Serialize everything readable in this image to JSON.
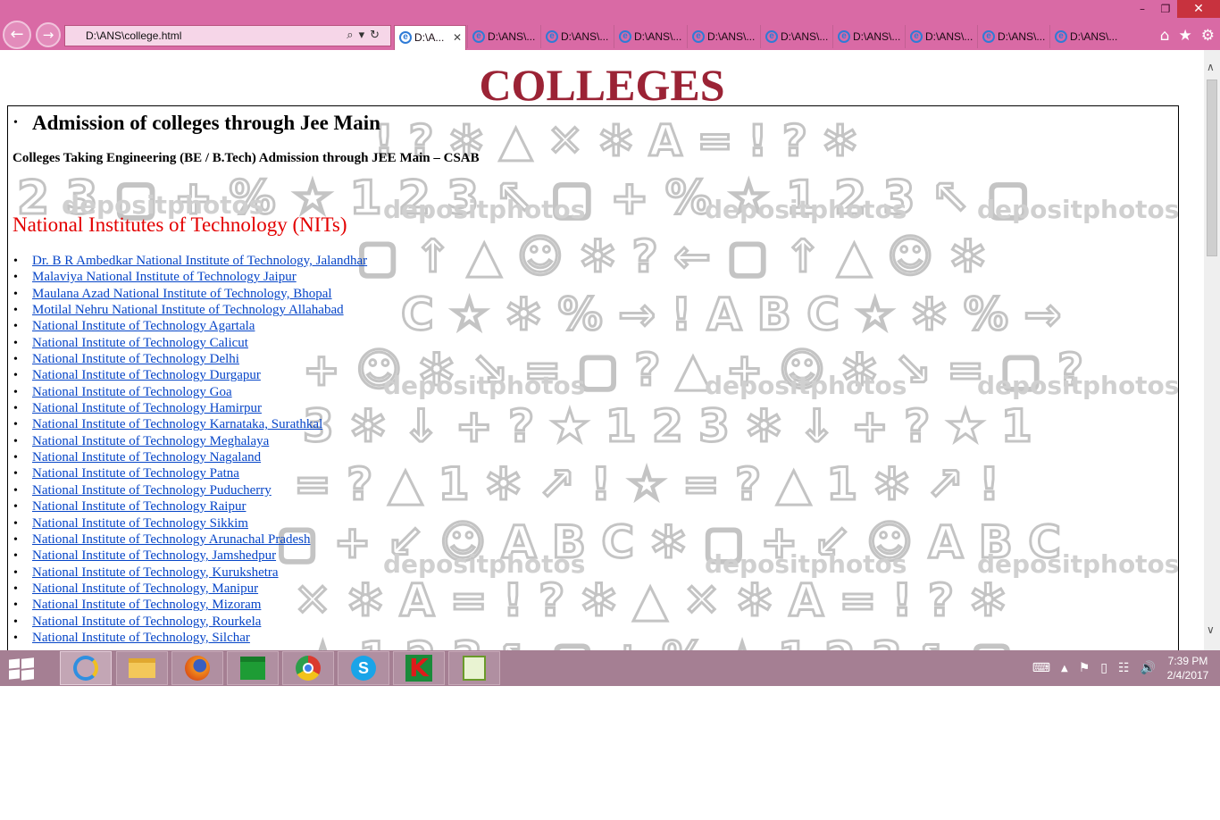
{
  "browser": {
    "address": "D:\\ANS\\college.html",
    "tabs": [
      {
        "label": "D:\\A..."
      },
      {
        "label": "D:\\ANS\\..."
      },
      {
        "label": "D:\\ANS\\..."
      },
      {
        "label": "D:\\ANS\\..."
      },
      {
        "label": "D:\\ANS\\..."
      },
      {
        "label": "D:\\ANS\\..."
      },
      {
        "label": "D:\\ANS\\..."
      },
      {
        "label": "D:\\ANS\\..."
      },
      {
        "label": "D:\\ANS\\..."
      },
      {
        "label": "D:\\ANS\\..."
      }
    ]
  },
  "page": {
    "title": "COLLEGES",
    "admission_heading": "Admission of colleges through Jee Main",
    "csab_line": "Colleges Taking Engineering (BE / B.Tech) Admission through JEE Main – CSAB",
    "nit_heading": "National Institutes of Technology (NITs)",
    "nits": [
      "Dr. B R Ambedkar National Institute of Technology, Jalandhar",
      "Malaviya National Institute of Technology Jaipur",
      "Maulana Azad National Institute of Technology, Bhopal",
      "Motilal Nehru National Institute of Technology Allahabad",
      "National Institute of Technology Agartala",
      "National Institute of Technology Calicut",
      "National Institute of Technology Delhi",
      "National Institute of Technology Durgapur",
      "National Institute of Technology Goa",
      "National Institute of Technology Hamirpur",
      "National Institute of Technology Karnataka, Surathkal",
      "National Institute of Technology Meghalaya",
      "National Institute of Technology Nagaland",
      "National Institute of Technology Patna",
      "National Institute of Technology Puducherry",
      "National Institute of Technology Raipur",
      "National Institute of Technology Sikkim",
      "National Institute of Technology Arunachal Pradesh",
      "National Institute of Technology, Jamshedpur",
      "National Institute of Technology, Kurukshetra",
      "National Institute of Technology, Manipur",
      "National Institute of Technology, Mizoram",
      "National Institute of Technology, Rourkela",
      "National Institute of Technology, Silchar"
    ],
    "watermark": "depositphotos"
  },
  "taskbar": {
    "time": "7:39 PM",
    "date": "2/4/2017"
  },
  "colors": {
    "chrome": "#d96aa5",
    "title": "#9b2335",
    "nit_heading": "#e30000",
    "link": "#0645c8",
    "taskbar": "#a57f93"
  },
  "icons": [
    "back-icon",
    "forward-icon",
    "search-icon",
    "refresh-icon",
    "home-icon",
    "favorites-star-icon",
    "gear-icon",
    "windows-start-icon",
    "ie-icon",
    "file-explorer-icon",
    "firefox-icon",
    "store-icon",
    "chrome-icon",
    "skype-icon",
    "kaspersky-icon",
    "notepad-plus-icon"
  ]
}
